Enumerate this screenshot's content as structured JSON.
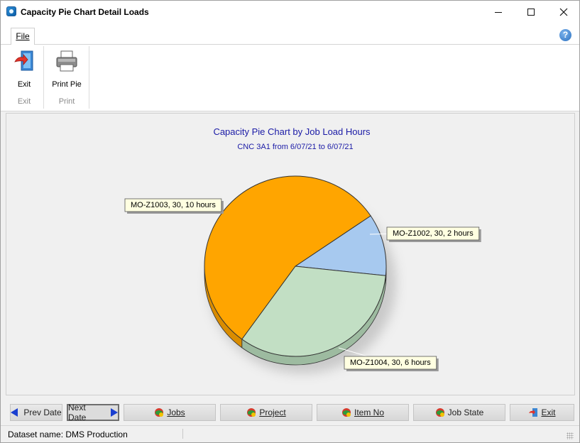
{
  "window": {
    "title": "Capacity Pie Chart Detail Loads"
  },
  "ribbon": {
    "tab_file": "File",
    "groups": [
      {
        "label": "Exit",
        "button_label": "Exit",
        "icon": "exit-door-icon"
      },
      {
        "label": "Print",
        "button_label": "Print Pie",
        "icon": "printer-icon"
      }
    ]
  },
  "chart_data": {
    "type": "pie",
    "title": "Capacity Pie Chart by Job Load Hours",
    "subtitle": "CNC 3A1 from 6/07/21 to 6/07/21",
    "slices": [
      {
        "label": "MO-Z1002, 30, 2 hours",
        "value": 2,
        "color": "#a7c9ef",
        "side_color": "#8fa9c8"
      },
      {
        "label": "MO-Z1004, 30, 6 hours",
        "value": 6,
        "color": "#c2dfc4",
        "side_color": "#9dbba0"
      },
      {
        "label": "MO-Z1003, 30, 10 hours",
        "value": 10,
        "color": "#ffa500",
        "side_color": "#d98c00"
      }
    ],
    "legend": "callout labels"
  },
  "buttons": {
    "prev_date": "Prev Date",
    "next_date": "Next Date",
    "jobs": "Jobs",
    "project": "Project",
    "item_no": "Item No",
    "job_state": "Job State",
    "exit": "Exit"
  },
  "status": {
    "dataset": "Dataset name:  DMS Production"
  },
  "colors": {
    "title_blue": "#1a1aa6",
    "arrow_blue": "#1a3fd0"
  }
}
